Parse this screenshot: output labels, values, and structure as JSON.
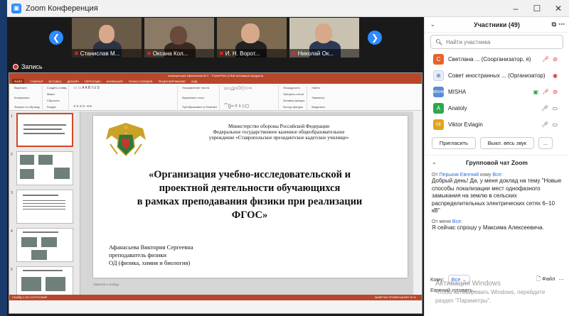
{
  "window": {
    "title": "Zoom Конференция",
    "minimize_icon": "minimize-icon",
    "maximize_icon": "maximize-icon",
    "close_icon": "close-icon"
  },
  "meeting": {
    "recording_label": "Запись",
    "participants_thumbs": [
      {
        "name": "Станислав М..."
      },
      {
        "name": "Оксана Кол..."
      },
      {
        "name": "И. Н. Ворот..."
      },
      {
        "name": "Николай Ок..."
      }
    ]
  },
  "ppt": {
    "window_title": "конференция Афанасьева В.С. · PowerPoint (Сбой активации продукта)",
    "tabs": [
      "ФАЙЛ",
      "ГЛАВНАЯ",
      "ВСТАВКА",
      "ДИЗАЙН",
      "ПЕРЕХОДЫ",
      "АНИМАЦИЯ",
      "ПОКАЗ СЛАЙДОВ",
      "РЕЦЕНЗИРОВАНИЕ",
      "ВИД"
    ],
    "ribbon": {
      "paste": [
        "Вырезать",
        "Копировать",
        "Формат по образцу"
      ],
      "slides": [
        "Создать слайд",
        "Макет",
        "Сбросить",
        "Раздел"
      ],
      "paragraph": [
        "Направление текста",
        "Выровнять текст",
        "Преобразовать в SmartArt"
      ],
      "drawing": [
        "Упорядочить",
        "Экспресс-стили",
        "Заливка фигуры",
        "Контур фигуры",
        "Эффекты фигуры"
      ],
      "editing": [
        "Найти",
        "Заменить",
        "Выделить"
      ]
    },
    "slide": {
      "ministry": [
        "Министерство обороны Российской Федерации",
        "Федеральное государственное казенное общеобразовательное",
        "учреждение «Ставропольское президентское кадетское училище»"
      ],
      "title_lines": [
        "«Организация учебно-исследовательской и",
        "проектной деятельности обучающихся",
        "в рамках преподавания физики при реализации",
        "ФГОС»"
      ],
      "author_lines": [
        "Афанасьева Виктория Сергеевна",
        "преподаватель физики",
        "ОД (физика, химия и биология)"
      ]
    },
    "notes_placeholder": "Заметки к слайду",
    "status": {
      "left": "СЛАЙД 1 ИЗ 13    РУССКИЙ",
      "right": "ЗАМЕТКИ    ПРИМЕЧАНИЯ    76 %"
    },
    "slide_numbers": [
      "1",
      "2",
      "3",
      "4",
      "5"
    ]
  },
  "participants_panel": {
    "title": "Участники (49)",
    "search_placeholder": "Найти участника",
    "participants": [
      {
        "initial": "С",
        "name": "Светлана ... (Соорганизатор, я)",
        "color": "#e8622d"
      },
      {
        "initial": "",
        "name": "Совет иностранных ... (Организатор)",
        "color": "#ffffff"
      },
      {
        "initial": "MISHA",
        "name": "MISHA",
        "color": "#5b8dd6"
      },
      {
        "initial": "A",
        "name": "Anatoly",
        "color": "#2aa84a"
      },
      {
        "initial": "VE",
        "name": "Viktor Evlagin",
        "color": "#e0a21d"
      }
    ],
    "invite_label": "Пригласить",
    "mute_all_label": "Выкл. весь звук",
    "more_label": "..."
  },
  "chat": {
    "title": "Групповой чат Zoom",
    "messages": [
      {
        "meta_prefix": "От ",
        "from": "Перьков Евгений",
        "meta_mid": " кому ",
        "to": "Все",
        "meta_suffix": ":",
        "text": "Добрый день! Да, у меня доклад на тему \"Новые способы локализации мест однофазного замыкания на землю в сельских распределительных электрических сетях 6–10 кВ\""
      },
      {
        "meta_prefix": "От меня ",
        "from": "",
        "meta_mid": "",
        "to": "Все",
        "meta_suffix": ":",
        "text": "Я сейчас спрошу  у Максима Алексеевича."
      }
    ],
    "to_label": "Кому:",
    "to_value": "Все",
    "file_label": "Файл",
    "typing": "Евгений готоветь..."
  },
  "watermark": {
    "line1": "Активация Windows",
    "line2": "Чтобы активировать Windows, перейдите",
    "line3": "раздел \"Параметры\"."
  },
  "colors": {
    "zoom_blue": "#2d8cff",
    "ppt_red": "#b7472a",
    "mute_red": "#e02828"
  }
}
